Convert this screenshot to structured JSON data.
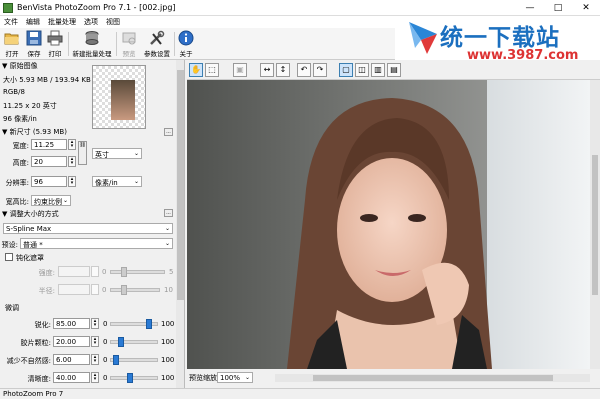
{
  "window": {
    "title": "BenVista PhotoZoom Pro 7.1 - [002.jpg]",
    "min": "—",
    "max": "□",
    "close": "✕"
  },
  "menu": [
    "文件",
    "编辑",
    "批量处理",
    "选项",
    "视图"
  ],
  "toolbar": [
    {
      "label": "打开",
      "icon": "folder-open-icon",
      "enabled": true
    },
    {
      "label": "保存",
      "icon": "save-icon",
      "enabled": true
    },
    {
      "label": "打印",
      "icon": "printer-icon",
      "enabled": true
    },
    {
      "label": "新建批量处理",
      "icon": "batch-icon",
      "enabled": true
    },
    {
      "label": "预览",
      "icon": "preview-icon",
      "enabled": false
    },
    {
      "label": "参数设置",
      "icon": "tools-icon",
      "enabled": true
    },
    {
      "label": "关于",
      "icon": "info-icon",
      "enabled": true
    }
  ],
  "logo": {
    "text": "统一下载站",
    "url": "www.3987.com"
  },
  "original": {
    "header": "▼ 原始图像",
    "size": "大小 5.93 MB / 193.94 KB",
    "mode": "RGB/8",
    "dims": "11.25 x 20 英寸",
    "res": "96 像素/in"
  },
  "newsize": {
    "header": "▼ 新尺寸 (5.93 MB)",
    "width_label": "宽度:",
    "width": "11.25",
    "height_label": "高度:",
    "height": "20",
    "unit": "英寸",
    "res_label": "分辨率:",
    "res": "96",
    "res_unit": "像素/in",
    "aspect_label": "宽高比:",
    "aspect": "约束比例"
  },
  "method": {
    "header": "▼ 调整大小的方式",
    "algorithm": "S-Spline Max",
    "preset_label": "预设:",
    "preset": "普通 *"
  },
  "sharpen": {
    "check_label": "钝化遮罩",
    "strength_label": "强度:",
    "radius_label": "半径:",
    "s_min": "0",
    "s_max": "5",
    "r_min": "0",
    "r_max": "10"
  },
  "tweak": {
    "header": "微调",
    "rows": [
      {
        "label": "锐化:",
        "value": "85.00",
        "min": "0",
        "max": "100",
        "level": 0.85
      },
      {
        "label": "胶片颗粒:",
        "value": "20.00",
        "min": "0",
        "max": "100",
        "level": 0.2
      },
      {
        "label": "减少不自然感:",
        "value": "6.00",
        "min": "0",
        "max": "100",
        "level": 0.06
      },
      {
        "label": "清晰度:",
        "value": "40.00",
        "min": "0",
        "max": "100",
        "level": 0.4
      }
    ]
  },
  "preview": {
    "zoom_label": "预览缩放:",
    "zoom": "100%"
  },
  "status": "PhotoZoom Pro 7"
}
